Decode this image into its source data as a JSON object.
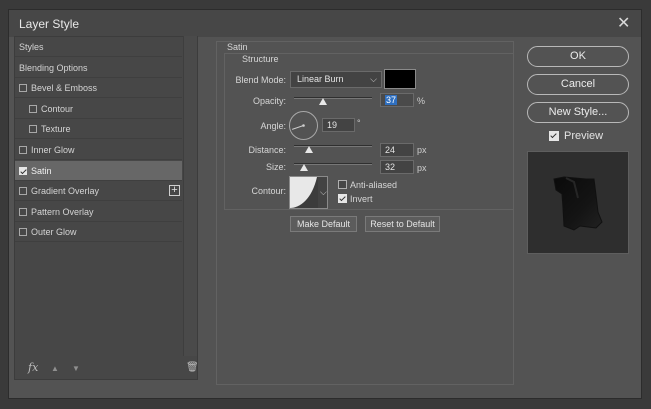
{
  "dialog": {
    "title": "Layer Style",
    "close_glyph": "✕"
  },
  "styles_list": {
    "items": [
      {
        "label": "Styles",
        "has_checkbox": false,
        "checked": false,
        "indent": 0
      },
      {
        "label": "Blending Options",
        "has_checkbox": false,
        "checked": false,
        "indent": 0
      },
      {
        "label": "Bevel & Emboss",
        "has_checkbox": true,
        "checked": false,
        "indent": 0
      },
      {
        "label": "Contour",
        "has_checkbox": true,
        "checked": false,
        "indent": 1
      },
      {
        "label": "Texture",
        "has_checkbox": true,
        "checked": false,
        "indent": 1
      },
      {
        "label": "Inner Glow",
        "has_checkbox": true,
        "checked": false,
        "indent": 0
      },
      {
        "label": "Satin",
        "has_checkbox": true,
        "checked": true,
        "indent": 0,
        "selected": true
      },
      {
        "label": "Gradient Overlay",
        "has_checkbox": true,
        "checked": false,
        "indent": 0,
        "has_add": true
      },
      {
        "label": "Pattern Overlay",
        "has_checkbox": true,
        "checked": false,
        "indent": 0
      },
      {
        "label": "Outer Glow",
        "has_checkbox": true,
        "checked": false,
        "indent": 0
      }
    ],
    "footer": {
      "fx": "fx",
      "up": "▲",
      "down": "▼",
      "trash": "🗑"
    }
  },
  "satin": {
    "group_label": "Satin",
    "structure_label": "Structure",
    "blend_mode": {
      "label": "Blend Mode:",
      "value": "Linear Burn"
    },
    "color_swatch": "#000000",
    "opacity": {
      "label": "Opacity:",
      "value": "37",
      "unit": "%",
      "fraction": 0.37
    },
    "angle": {
      "label": "Angle:",
      "value": "19",
      "unit": "°"
    },
    "distance": {
      "label": "Distance:",
      "value": "24",
      "unit": "px",
      "fraction": 0.19
    },
    "size": {
      "label": "Size:",
      "value": "32",
      "unit": "px",
      "fraction": 0.13
    },
    "contour": {
      "label": "Contour:"
    },
    "anti_aliased": {
      "label": "Anti-aliased",
      "checked": false
    },
    "invert": {
      "label": "Invert",
      "checked": true
    },
    "buttons": {
      "make_default": "Make Default",
      "reset_default": "Reset to Default"
    }
  },
  "right": {
    "ok": "OK",
    "cancel": "Cancel",
    "new_style": "New Style...",
    "preview_label": "Preview",
    "preview_checked": true
  },
  "colors": {
    "selected_row": "#676767",
    "highlight": "#2f6fbf"
  }
}
